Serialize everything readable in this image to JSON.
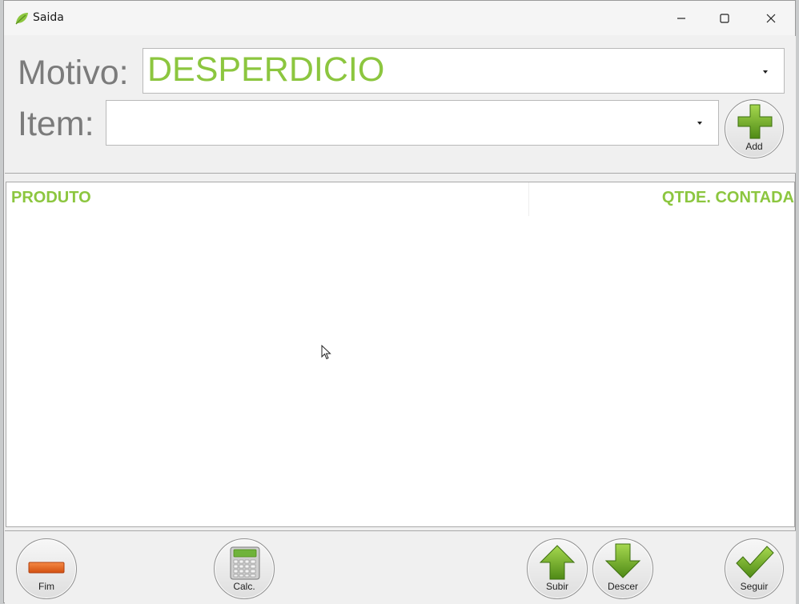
{
  "window": {
    "title": "Saida",
    "icon": "leaf-icon"
  },
  "form": {
    "motivo_label": "Motivo:",
    "motivo_value": "DESPERDICIO",
    "item_label": "Item:",
    "item_value": "",
    "add_label": "Add"
  },
  "list": {
    "columns": [
      "PRODUTO",
      "QTDE. CONTADA"
    ],
    "rows": []
  },
  "toolbar": {
    "fim_label": "Fim",
    "calc_label": "Calc.",
    "subir_label": "Subir",
    "descer_label": "Descer",
    "seguir_label": "Seguir"
  },
  "colors": {
    "accent_green": "#8cc63f",
    "label_gray": "#7b7b7b",
    "fim_orange": "#e8641e"
  }
}
